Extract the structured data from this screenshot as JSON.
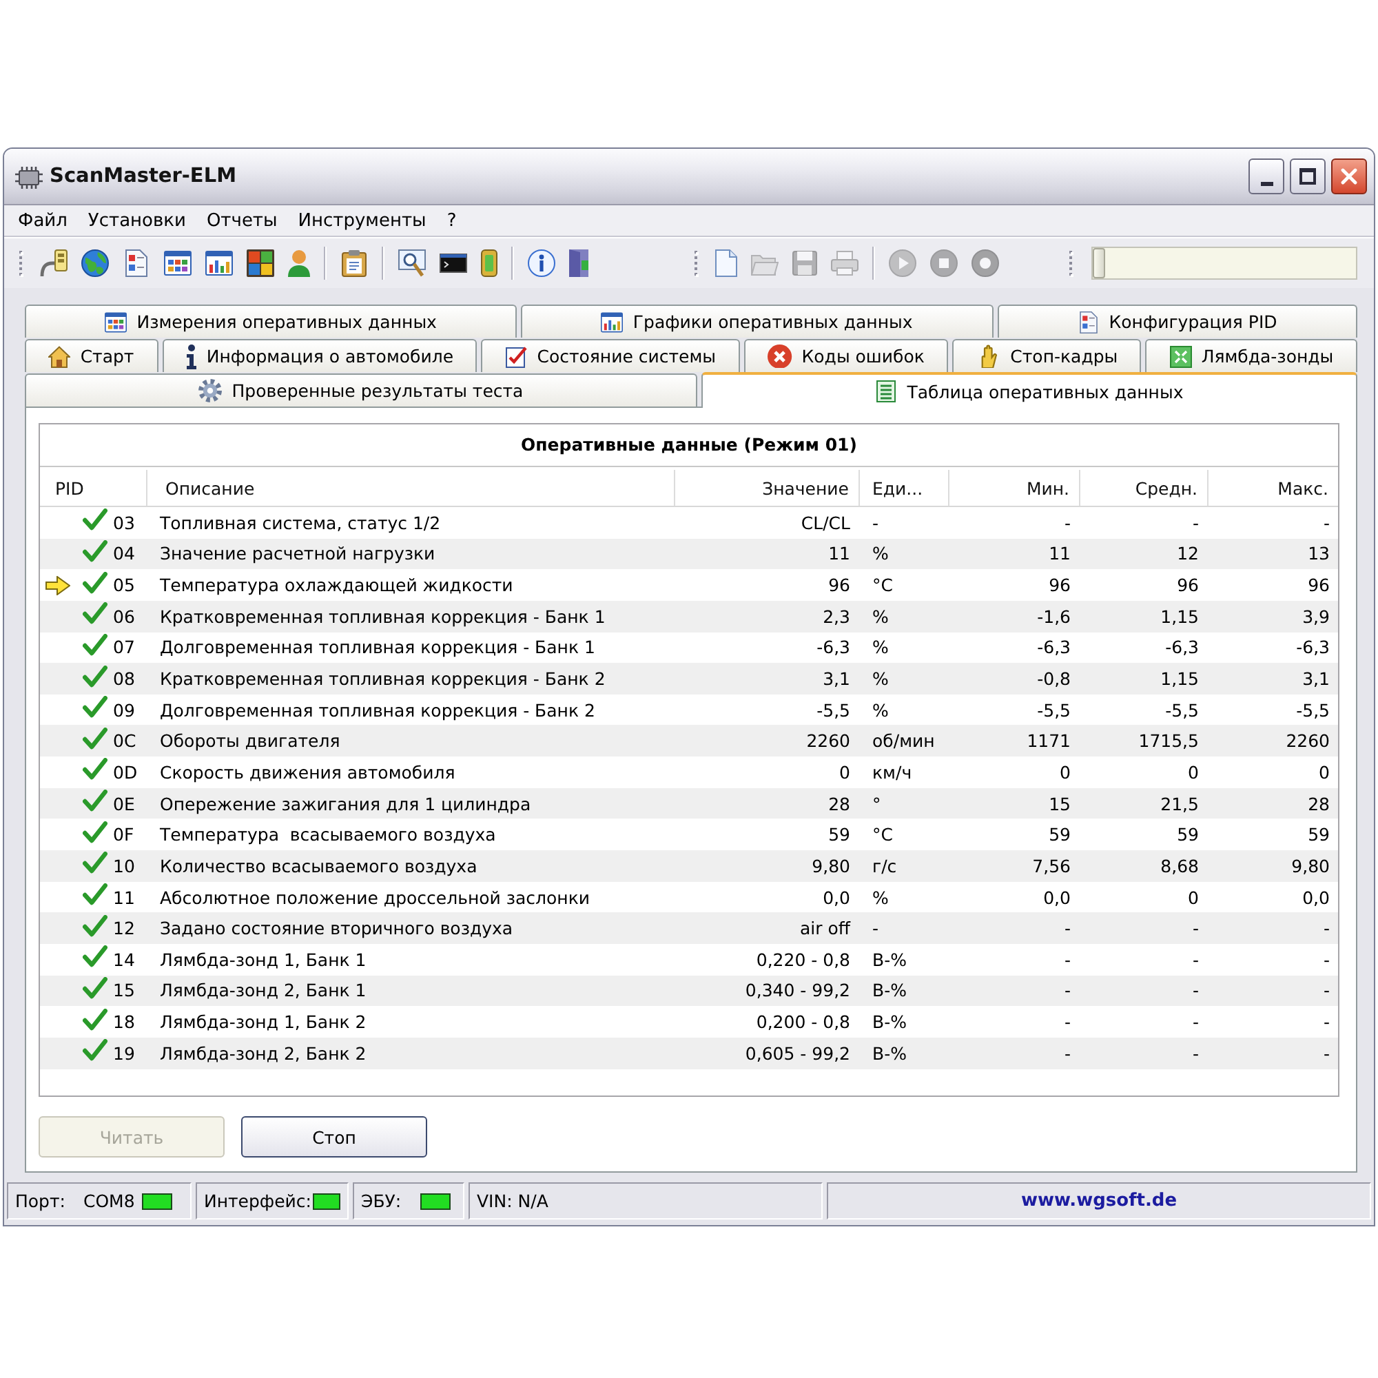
{
  "window": {
    "title": "ScanMaster-ELM"
  },
  "menu": [
    "Файл",
    "Установки",
    "Отчеты",
    "Инструменты",
    "?"
  ],
  "toolbar": {
    "bands": [
      {
        "groups": [
          {
            "buttons": [
              {
                "kind": "connect",
                "disabled": false
              },
              {
                "kind": "globe",
                "disabled": false
              },
              {
                "kind": "report",
                "disabled": false
              },
              {
                "kind": "grid",
                "disabled": false
              },
              {
                "kind": "chart",
                "disabled": false
              },
              {
                "kind": "tiles",
                "disabled": false
              },
              {
                "kind": "person",
                "disabled": false
              }
            ]
          },
          {
            "buttons": [
              {
                "kind": "clipboard",
                "disabled": false
              }
            ]
          },
          {
            "buttons": [
              {
                "kind": "magnifier",
                "disabled": false
              },
              {
                "kind": "terminal",
                "disabled": false
              },
              {
                "kind": "battery",
                "disabled": false
              }
            ]
          },
          {
            "buttons": [
              {
                "kind": "info",
                "disabled": false
              },
              {
                "kind": "exit",
                "disabled": false
              }
            ]
          }
        ]
      },
      {
        "groups": [
          {
            "buttons": [
              {
                "kind": "new",
                "disabled": false
              },
              {
                "kind": "open",
                "disabled": true
              },
              {
                "kind": "save",
                "disabled": true
              },
              {
                "kind": "print",
                "disabled": true
              }
            ]
          },
          {
            "buttons": [
              {
                "kind": "play",
                "disabled": true
              },
              {
                "kind": "stop",
                "disabled": true
              },
              {
                "kind": "record",
                "disabled": true
              }
            ]
          }
        ]
      },
      {
        "slider": {
          "level": 0
        }
      }
    ]
  },
  "tab_rows": [
    {
      "tabs": [
        {
          "label": "Измерения оперативных данных",
          "kind": "grid",
          "selected": false
        },
        {
          "label": "Графики оперативных данных",
          "kind": "chart",
          "selected": false
        },
        {
          "label": "Конфигурация PID",
          "kind": "config",
          "selected": false
        }
      ]
    },
    {
      "tabs": [
        {
          "label": "Старт",
          "kind": "home",
          "selected": false
        },
        {
          "label": "Информация о автомобиле",
          "kind": "info",
          "selected": false
        },
        {
          "label": "Состояние системы",
          "kind": "status",
          "selected": false
        },
        {
          "label": "Коды ошибок",
          "kind": "error",
          "selected": false
        },
        {
          "label": "Стоп-кадры",
          "kind": "freeze",
          "selected": false
        },
        {
          "label": "Лямбда-зонды",
          "kind": "lambda",
          "selected": false
        }
      ]
    },
    {
      "tabs": [
        {
          "label": "Проверенные результаты теста",
          "kind": "test",
          "selected": false
        },
        {
          "label": "Таблица оперативных данных",
          "kind": "table",
          "selected": true
        }
      ]
    }
  ],
  "table": {
    "title": "Оперативные данные (Режим 01)",
    "columns": [
      "PID",
      "Описание",
      "Значение",
      "Еди...",
      "Мин.",
      "Средн.",
      "Макс."
    ],
    "rows": [
      {
        "pid": "03",
        "description": "Топливная система, статус 1/2",
        "value": "CL/CL",
        "unit": "-",
        "min": "-",
        "avg": "-",
        "max": "-",
        "checked": true,
        "selected": false
      },
      {
        "pid": "04",
        "description": "Значение расчетной нагрузки",
        "value": "11",
        "unit": "%",
        "min": "11",
        "avg": "12",
        "max": "13",
        "checked": true,
        "selected": false
      },
      {
        "pid": "05",
        "description": "Температура охлаждающей жидкости",
        "value": "96",
        "unit": "°C",
        "min": "96",
        "avg": "96",
        "max": "96",
        "checked": true,
        "selected": true
      },
      {
        "pid": "06",
        "description": "Кратковременная топливная коррекция - Банк 1",
        "value": "2,3",
        "unit": "%",
        "min": "-1,6",
        "avg": "1,15",
        "max": "3,9",
        "checked": true,
        "selected": false
      },
      {
        "pid": "07",
        "description": "Долговременная топливная коррекция - Банк 1",
        "value": "-6,3",
        "unit": "%",
        "min": "-6,3",
        "avg": "-6,3",
        "max": "-6,3",
        "checked": true,
        "selected": false
      },
      {
        "pid": "08",
        "description": "Кратковременная топливная коррекция - Банк 2",
        "value": "3,1",
        "unit": "%",
        "min": "-0,8",
        "avg": "1,15",
        "max": "3,1",
        "checked": true,
        "selected": false
      },
      {
        "pid": "09",
        "description": "Долговременная топливная коррекция - Банк 2",
        "value": "-5,5",
        "unit": "%",
        "min": "-5,5",
        "avg": "-5,5",
        "max": "-5,5",
        "checked": true,
        "selected": false
      },
      {
        "pid": "0C",
        "description": "Обороты двигателя",
        "value": "2260",
        "unit": "об/мин",
        "min": "1171",
        "avg": "1715,5",
        "max": "2260",
        "checked": true,
        "selected": false
      },
      {
        "pid": "0D",
        "description": "Скорость движения автомобиля",
        "value": "0",
        "unit": "км/ч",
        "min": "0",
        "avg": "0",
        "max": "0",
        "checked": true,
        "selected": false
      },
      {
        "pid": "0E",
        "description": "Опережение зажигания для 1 цилиндра",
        "value": "28",
        "unit": "°",
        "min": "15",
        "avg": "21,5",
        "max": "28",
        "checked": true,
        "selected": false
      },
      {
        "pid": "0F",
        "description": "Температура  всасываемого воздуха",
        "value": "59",
        "unit": "°C",
        "min": "59",
        "avg": "59",
        "max": "59",
        "checked": true,
        "selected": false
      },
      {
        "pid": "10",
        "description": "Количество всасываемого воздуха",
        "value": "9,80",
        "unit": "г/с",
        "min": "7,56",
        "avg": "8,68",
        "max": "9,80",
        "checked": true,
        "selected": false
      },
      {
        "pid": "11",
        "description": "Абсолютное положение дроссельной заслонки",
        "value": "0,0",
        "unit": "%",
        "min": "0,0",
        "avg": "0",
        "max": "0,0",
        "checked": true,
        "selected": false
      },
      {
        "pid": "12",
        "description": "Задано состояние вторичного воздуха",
        "value": "air off",
        "unit": "-",
        "min": "-",
        "avg": "-",
        "max": "-",
        "checked": true,
        "selected": false
      },
      {
        "pid": "14",
        "description": "Лямбда-зонд 1, Банк 1",
        "value": "0,220 - 0,8",
        "unit": "В-%",
        "min": "-",
        "avg": "-",
        "max": "-",
        "checked": true,
        "selected": false
      },
      {
        "pid": "15",
        "description": "Лямбда-зонд 2, Банк 1",
        "value": "0,340 - 99,2",
        "unit": "В-%",
        "min": "-",
        "avg": "-",
        "max": "-",
        "checked": true,
        "selected": false
      },
      {
        "pid": "18",
        "description": "Лямбда-зонд 1, Банк 2",
        "value": "0,200 - 0,8",
        "unit": "В-%",
        "min": "-",
        "avg": "-",
        "max": "-",
        "checked": true,
        "selected": false
      },
      {
        "pid": "19",
        "description": "Лямбда-зонд 2, Банк 2",
        "value": "0,605 - 99,2",
        "unit": "В-%",
        "min": "-",
        "avg": "-",
        "max": "-",
        "checked": true,
        "selected": false
      }
    ]
  },
  "buttons": [
    {
      "label": "Читать",
      "disabled": true
    },
    {
      "label": "Стоп",
      "disabled": false
    }
  ],
  "status_bar": {
    "panels": [
      {
        "label": "Порт:",
        "value": "COM8",
        "on": true
      },
      {
        "label": "Интерфейс:",
        "on": true
      },
      {
        "label": "ЭБУ:",
        "on": true
      }
    ],
    "vin": "VIN: N/A",
    "website": "www.wgsoft.de"
  }
}
